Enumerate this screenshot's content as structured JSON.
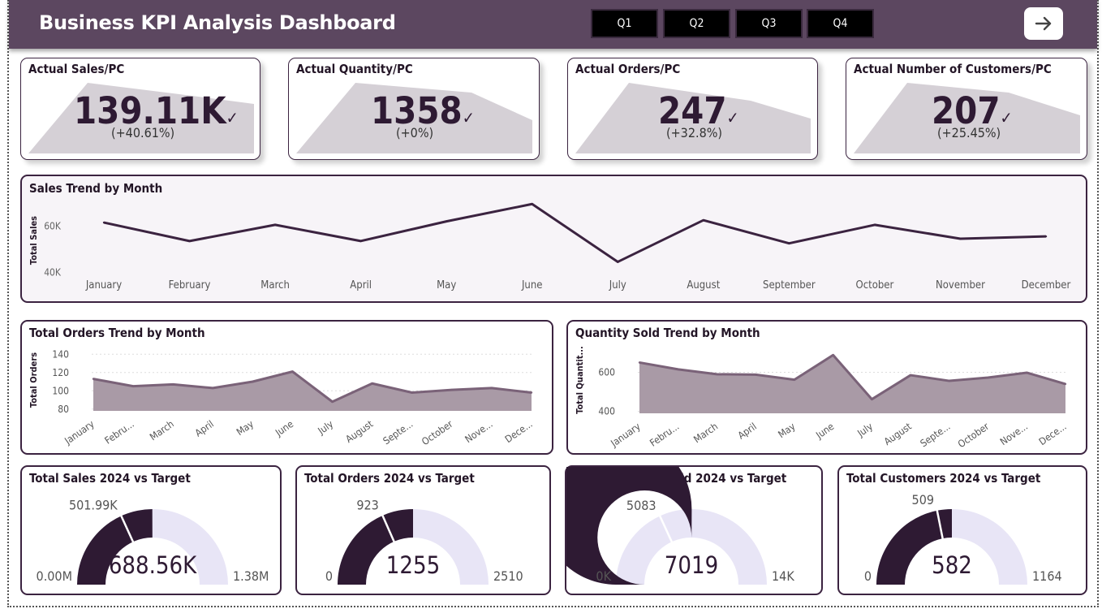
{
  "header": {
    "title": "Business KPI Analysis Dashboard",
    "quarters": [
      "Q1",
      "Q2",
      "Q3",
      "Q4"
    ],
    "nav_icon": "arrow-right-icon"
  },
  "kpis": [
    {
      "title": "Actual Sales/PC",
      "value": "139.11K",
      "delta": "(+40.61%)",
      "check": "✓"
    },
    {
      "title": "Actual Quantity/PC",
      "value": "1358",
      "delta": "(+0%)",
      "check": "✓"
    },
    {
      "title": "Actual Orders/PC",
      "value": "247",
      "delta": "(+32.8%)",
      "check": "✓"
    },
    {
      "title": "Actual Number of Customers/PC",
      "value": "207",
      "delta": "(+25.45%)",
      "check": "✓"
    }
  ],
  "colors": {
    "header": "#5c4760",
    "line": "#3b2340",
    "area_fill": "#a99aa6",
    "area_line": "#7a6278",
    "gauge_value": "#2e1a33",
    "gauge_remaining": "#e8e5f6",
    "kpi_shape": "#d5d0d6"
  },
  "chart_data": [
    {
      "type": "line",
      "title": "Sales Trend by Month",
      "ylabel": "Total Sales",
      "xlabel": "",
      "categories": [
        "January",
        "February",
        "March",
        "April",
        "May",
        "June",
        "July",
        "August",
        "September",
        "October",
        "November",
        "December"
      ],
      "values": [
        61500,
        53500,
        60500,
        53500,
        62000,
        69500,
        44500,
        62500,
        52500,
        60500,
        54500,
        55500
      ],
      "yticks": [
        {
          "value": 40000,
          "label": "40K"
        },
        {
          "value": 60000,
          "label": "60K"
        }
      ],
      "ylim": [
        38000,
        71000
      ]
    },
    {
      "type": "area",
      "title": "Total Orders Trend by Month",
      "ylabel": "Total Orders",
      "xlabel": "",
      "categories": [
        "January",
        "Febru...",
        "March",
        "April",
        "May",
        "June",
        "July",
        "August",
        "Septe...",
        "October",
        "Nove...",
        "Dece..."
      ],
      "values": [
        113,
        105,
        107,
        103,
        110,
        121,
        88,
        108,
        98,
        101,
        103,
        98
      ],
      "yticks": [
        {
          "value": 80,
          "label": "80"
        },
        {
          "value": 100,
          "label": "100"
        },
        {
          "value": 120,
          "label": "120"
        },
        {
          "value": 140,
          "label": "140"
        }
      ],
      "ylim": [
        78,
        142
      ]
    },
    {
      "type": "area",
      "title": "Quantity Sold Trend by Month",
      "ylabel": "Total Quantit...",
      "xlabel": "",
      "categories": [
        "January",
        "Febru...",
        "March",
        "April",
        "May",
        "June",
        "July",
        "August",
        "Septe...",
        "October",
        "Nove...",
        "Dece..."
      ],
      "values": [
        650,
        615,
        590,
        588,
        562,
        688,
        462,
        585,
        556,
        573,
        598,
        540
      ],
      "yticks": [
        {
          "value": 400,
          "label": "400"
        },
        {
          "value": 600,
          "label": "600"
        }
      ],
      "ylim": [
        390,
        710
      ]
    },
    {
      "type": "gauge",
      "title": "Total Sales 2024 vs Target",
      "value": 688560,
      "value_label": "688.56K",
      "min": 0,
      "min_label": "0.00M",
      "max": 1380000,
      "max_label": "1.38M",
      "target": 501990,
      "target_label": "501.99K"
    },
    {
      "type": "gauge",
      "title": "Total Orders 2024 vs Target",
      "value": 1255,
      "value_label": "1255",
      "min": 0,
      "min_label": "0",
      "max": 2510,
      "max_label": "2510",
      "target": 923,
      "target_label": "923"
    },
    {
      "type": "gauge",
      "title": "Total Quantity Sold 2024 vs Target",
      "value": 7019,
      "value_label": "7019",
      "min": 0,
      "min_label": "0K",
      "max": 14000,
      "max_label": "14K",
      "target": 5083,
      "target_label": "5083"
    },
    {
      "type": "gauge",
      "title": "Total Customers 2024 vs Target",
      "value": 582,
      "value_label": "582",
      "min": 0,
      "min_label": "0",
      "max": 1164,
      "max_label": "1164",
      "target": 509,
      "target_label": "509"
    }
  ]
}
